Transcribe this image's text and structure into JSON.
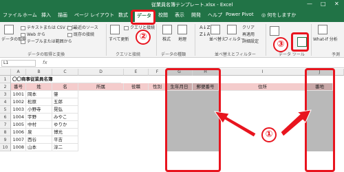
{
  "window": {
    "title": "従業員名簿テンプレート.xlsx - Excel"
  },
  "tabs": [
    "ファイル",
    "ホーム",
    "挿入",
    "描画",
    "ページ レイアウト",
    "数式",
    "データ",
    "校閲",
    "表示",
    "開発",
    "ヘルプ",
    "Power Pivot"
  ],
  "tell_me": "何をしますか",
  "ribbon": {
    "get_data": "データの取得",
    "get_data_sub": "▾",
    "text_csv": "テキストまたは CSV から",
    "from_web": "Web から",
    "from_table": "テーブルまたは範囲から",
    "recent_sources": "最近のソース",
    "existing_conn": "既存の接続",
    "refresh_all": "すべて更新",
    "queries": "クエリと接続",
    "stocks": "株式",
    "geography": "地理",
    "sort": "並べ替え",
    "filter": "フィルター",
    "clear": "クリア",
    "reapply": "再適用",
    "advanced": "詳細設定",
    "whatif": "What-If 分析",
    "forecast_sheet": "予測シート",
    "group_get": "データの取得と変換",
    "group_query": "クエリと接続",
    "group_types": "データの種類",
    "group_sort": "並べ替えとフィルター",
    "group_tools": "データ ツール",
    "group_forecast": "予測"
  },
  "formula_bar": {
    "namebox": "L1",
    "fx": "fx"
  },
  "columns": [
    "A",
    "B",
    "C",
    "D",
    "E",
    "F",
    "G",
    "H",
    "I",
    "J"
  ],
  "sheet_title": "〇〇商事従業員名簿",
  "headers": [
    "番号",
    "姓",
    "名",
    "所属",
    "役職",
    "性別",
    "生年月日",
    "郵便番号",
    "住所",
    "番地"
  ],
  "rows": [
    {
      "no": "1001",
      "sei": "岡本",
      "mei": "肇"
    },
    {
      "no": "1002",
      "sei": "松原",
      "mei": "五郎"
    },
    {
      "no": "1003",
      "sei": "小野寺",
      "mei": "晃弘"
    },
    {
      "no": "1004",
      "sei": "宇野",
      "mei": "みやこ"
    },
    {
      "no": "1005",
      "sei": "中村",
      "mei": "ゆりか"
    },
    {
      "no": "1006",
      "sei": "泉",
      "mei": "博光"
    },
    {
      "no": "1007",
      "sei": "西谷",
      "mei": "平吉"
    },
    {
      "no": "1008",
      "sei": "山本",
      "mei": "淳二"
    }
  ],
  "row_numbers": [
    "1",
    "2",
    "3",
    "4",
    "5",
    "6",
    "7",
    "8",
    "9",
    "10"
  ],
  "annotations": {
    "one": "①",
    "two": "②",
    "three": "③"
  },
  "colors": {
    "excel_green": "#217346",
    "highlight_red": "#e8141e",
    "header_pink": "#f4cccc",
    "selected_gray": "#b9b9b9"
  }
}
